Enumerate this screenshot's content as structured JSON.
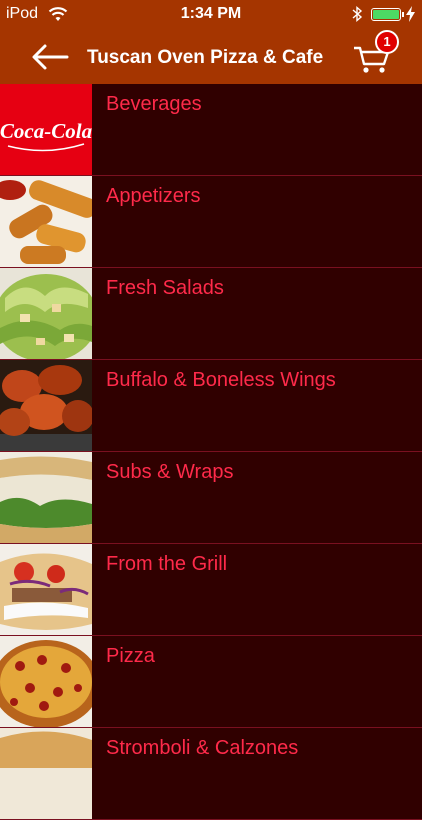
{
  "status_bar": {
    "carrier": "iPod",
    "time": "1:34 PM"
  },
  "nav": {
    "back_icon": "left-arrow-icon",
    "title": "Tuscan Oven Pizza & Cafe",
    "cart_icon": "shopping-cart-icon",
    "cart_count": "1"
  },
  "colors": {
    "nav_bg": "#a53500",
    "list_bg": "#300000",
    "label": "#ff2a4a",
    "divider": "#7a1020",
    "badge": "#e00000"
  },
  "categories": [
    {
      "label": "Beverages",
      "image": "coca-cola-logo"
    },
    {
      "label": "Appetizers",
      "image": "mozzarella-sticks-photo"
    },
    {
      "label": "Fresh Salads",
      "image": "caesar-salad-photo"
    },
    {
      "label": "Buffalo & Boneless Wings",
      "image": "buffalo-wings-photo"
    },
    {
      "label": "Subs & Wraps",
      "image": "wrap-photo"
    },
    {
      "label": "From the Grill",
      "image": "gyro-photo"
    },
    {
      "label": "Pizza",
      "image": "pizza-photo"
    },
    {
      "label": "Stromboli & Calzones",
      "image": "calzone-photo"
    }
  ]
}
